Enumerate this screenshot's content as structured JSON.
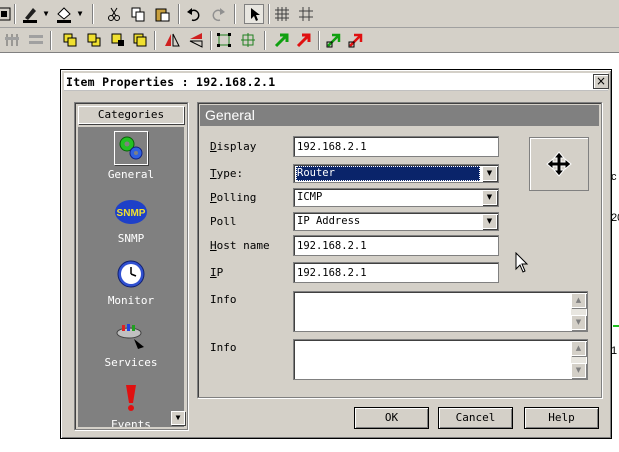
{
  "dialog": {
    "title": "Item Properties : 192.168.2.1",
    "close_symbol": "×"
  },
  "categories": {
    "header": "Categories",
    "items": [
      {
        "label": "General",
        "icon": "gears-icon",
        "selected": true
      },
      {
        "label": "SNMP",
        "icon": "snmp-icon",
        "icon_text": "SNMP"
      },
      {
        "label": "Monitor",
        "icon": "clock-icon"
      },
      {
        "label": "Services",
        "icon": "services-icon"
      },
      {
        "label": "Events",
        "icon": "exclamation-icon"
      }
    ]
  },
  "general": {
    "header": "General",
    "fields": {
      "display": {
        "label_u": "D",
        "label_rest": "isplay",
        "value": "192.168.2.1"
      },
      "type": {
        "label_u": "T",
        "label_rest": "ype:",
        "value": "Router"
      },
      "polling": {
        "label_u": "P",
        "label_rest": "olling",
        "value": "ICMP"
      },
      "poll": {
        "label": "Poll",
        "value": "IP Address"
      },
      "host_name": {
        "label_u": "H",
        "label_rest": "ost name",
        "value": "192.168.2.1"
      },
      "ip": {
        "label_u": "I",
        "label_rest": "P",
        "value": "192.168.2.1"
      },
      "info1": {
        "label": "Info",
        "value": ""
      },
      "info2": {
        "label": "Info",
        "value": ""
      }
    }
  },
  "buttons": {
    "ok": "OK",
    "cancel": "Cancel",
    "help": "Help"
  },
  "colors": {
    "accent": "#0a246a",
    "face": "#d4d0c8",
    "panel_dark": "#808080"
  },
  "workspace": {
    "marks": [
      "c",
      "20",
      "1"
    ]
  }
}
